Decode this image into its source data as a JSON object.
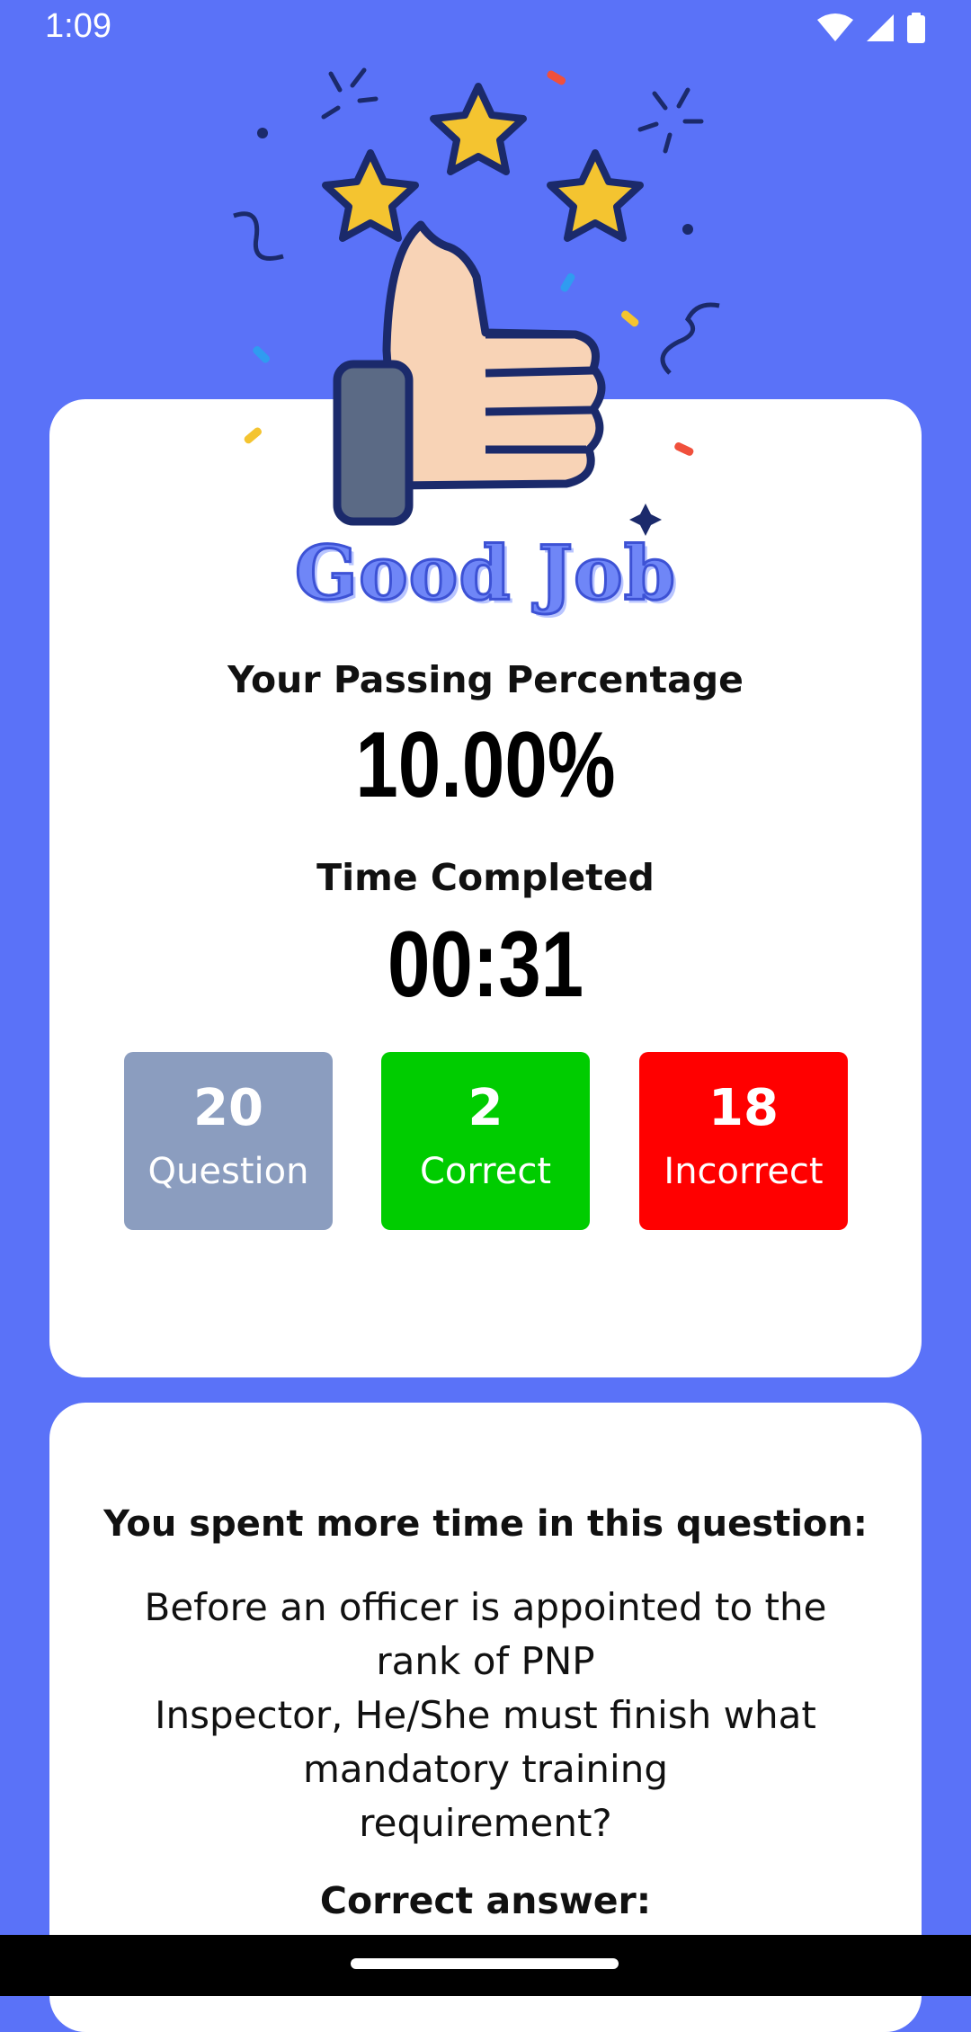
{
  "status_bar": {
    "time": "1:09",
    "icons": [
      "wifi-icon",
      "signal-icon",
      "battery-icon"
    ]
  },
  "result": {
    "banner": "Good Job",
    "passing_label": "Your Passing Percentage",
    "passing_value": "10.00%",
    "time_label": "Time Completed",
    "time_value": "00:31",
    "stats": {
      "question": {
        "count": "20",
        "label": "Question",
        "color": "#8b9dbf"
      },
      "correct": {
        "count": "2",
        "label": "Correct",
        "color": "#00cc00"
      },
      "incorrect": {
        "count": "18",
        "label": "Incorrect",
        "color": "#ff0000"
      }
    }
  },
  "detail": {
    "title": "You spent more time in this question:",
    "question_lines": [
      "Before an officer is appointed to the",
      "rank of PNP",
      "Inspector, He/She must finish what",
      "mandatory training",
      "requirement?"
    ],
    "correct_answer_label": "Correct answer:"
  },
  "colors": {
    "background": "#5a72f8",
    "card": "#ffffff",
    "banner_fill": "#6f86f7"
  },
  "illustration": {
    "icons": [
      "thumbs-up-icon",
      "star-icon",
      "confetti-icon"
    ]
  }
}
